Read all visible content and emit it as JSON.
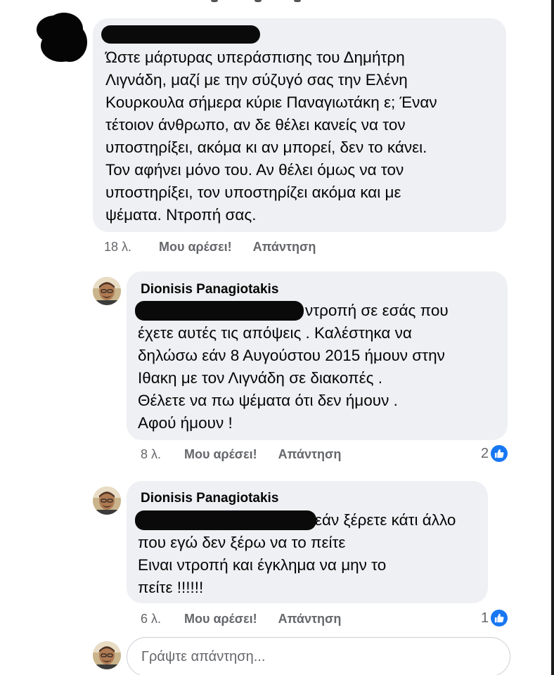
{
  "thread": {
    "comments": [
      {
        "author_redacted": true,
        "text": "Ώστε μάρτυρας υπεράσπισης του Δημήτρη\nΛιγνάδη, μαζί με την σύζυγό σας την Ελένη\nΚουρκουλα σήμερα κύριε Παναγιωτάκη ε; Έναν\nτέτοιον άνθρωπο, αν δε θέλει κανείς να τον\nυποστηρίξει, ακόμα κι αν μπορεί, δεν το κάνει.\nΤον αφήνει μόνο του. Αν θέλει όμως να τον\nυποστηρίξει, τον υποστηρίζει ακόμα και με\nψέματα. Ντροπή σας.",
        "age": "18 λ.",
        "like_label": "Μου αρέσει!",
        "reply_label": "Απάντηση"
      },
      {
        "author": "Dionisis Panagiotakis",
        "text_first": "ντροπή σε εσάς που",
        "text": "έχετε αυτές τις απόψεις . Καλέστηκα να\nδηλώσω εάν 8 Αυγούστου 2015 ήμουν στην\nΙθακη με τον Λιγνάδη σε διακοπές .\nΘέλετε να πω ψέματα ότι δεν ήμουν .\nΑφού ήμουν !",
        "age": "8 λ.",
        "like_label": "Μου αρέσει!",
        "reply_label": "Απάντηση",
        "reaction_count": "2",
        "reaction_icon": "thumbs-up-icon"
      },
      {
        "author": "Dionisis Panagiotakis",
        "text_first": "εάν ξέρετε κάτι άλλο",
        "text": "που εγώ δεν ξέρω να το πείτε\nΕιναι ντροπή και έγκλημα να μην το\nπείτε !!!!!!",
        "age": "6 λ.",
        "like_label": "Μου αρέσει!",
        "reply_label": "Απάντηση",
        "reaction_count": "1",
        "reaction_icon": "thumbs-up-icon"
      }
    ]
  },
  "reply_box": {
    "placeholder": "Γράψτε απάντηση..."
  },
  "colors": {
    "bubble": "#eff0f3",
    "meta_text": "#65676b",
    "like_blue": "#1877f2",
    "redaction": "#000000"
  }
}
